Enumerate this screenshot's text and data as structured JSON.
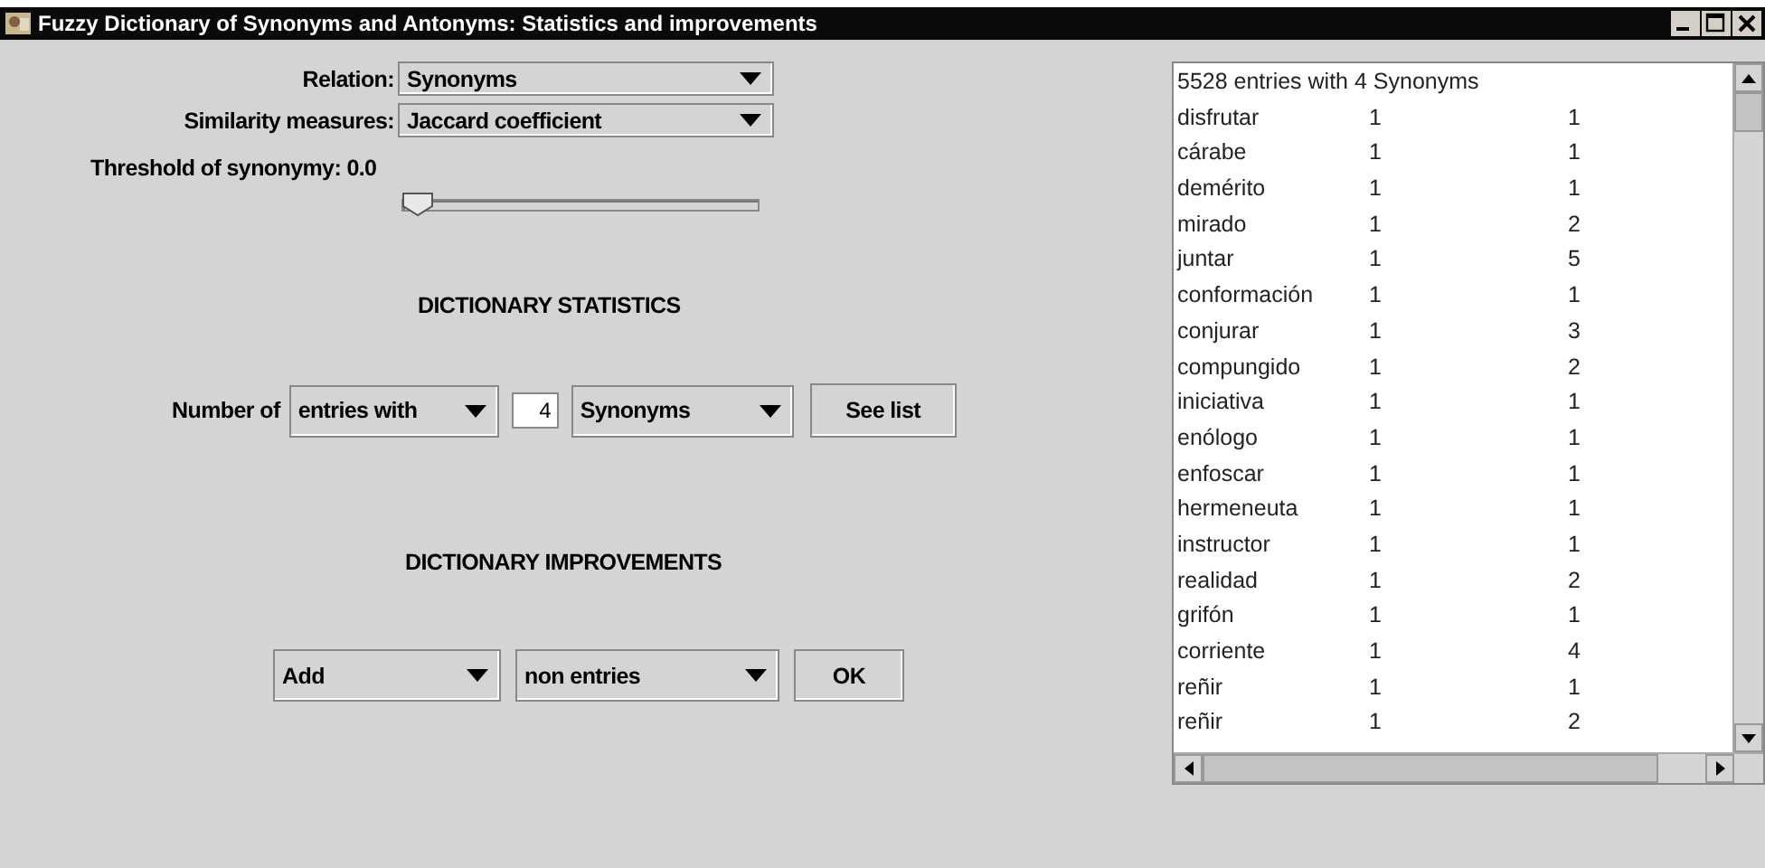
{
  "window": {
    "title": "Fuzzy Dictionary of Synonyms and Antonyms: Statistics and improvements"
  },
  "relation": {
    "label": "Relation:",
    "value": "Synonyms"
  },
  "similarity": {
    "label": "Similarity measures:",
    "value": "Jaccard coefficient"
  },
  "threshold": {
    "label": "Threshold of synonymy: 0.0",
    "level": 0
  },
  "statistics": {
    "heading": "DICTIONARY STATISTICS",
    "label": "Number of",
    "mode": "entries with",
    "count": "4",
    "relation": "Synonyms",
    "button": "See list"
  },
  "improvements": {
    "heading": "DICTIONARY IMPROVEMENTS",
    "action": "Add",
    "target": "non entries",
    "button": "OK"
  },
  "list": {
    "header": "5528 entries with 4 Synonyms",
    "rows": [
      {
        "word": "disfrutar",
        "column_2": "1",
        "column_3": "1"
      },
      {
        "word": "cárabe",
        "column_2": "1",
        "column_3": "1"
      },
      {
        "word": "demérito",
        "column_2": "1",
        "column_3": "1"
      },
      {
        "word": "mirado",
        "column_2": "1",
        "column_3": "2"
      },
      {
        "word": "juntar",
        "column_2": "1",
        "column_3": "5"
      },
      {
        "word": "conformación",
        "column_2": "1",
        "column_3": "1"
      },
      {
        "word": "conjurar",
        "column_2": "1",
        "column_3": "3"
      },
      {
        "word": "compungido",
        "column_2": "1",
        "column_3": "2"
      },
      {
        "word": "iniciativa",
        "column_2": "1",
        "column_3": "1"
      },
      {
        "word": "enólogo",
        "column_2": "1",
        "column_3": "1"
      },
      {
        "word": "enfoscar",
        "column_2": "1",
        "column_3": "1"
      },
      {
        "word": "hermeneuta",
        "column_2": "1",
        "column_3": "1"
      },
      {
        "word": "instructor",
        "column_2": "1",
        "column_3": "1"
      },
      {
        "word": "realidad",
        "column_2": "1",
        "column_3": "2"
      },
      {
        "word": "grifón",
        "column_2": "1",
        "column_3": "1"
      },
      {
        "word": "corriente",
        "column_2": "1",
        "column_3": "4"
      },
      {
        "word": "reñir",
        "column_2": "1",
        "column_3": "1"
      },
      {
        "word": "reñir",
        "column_2": "1",
        "column_3": "2"
      }
    ]
  }
}
